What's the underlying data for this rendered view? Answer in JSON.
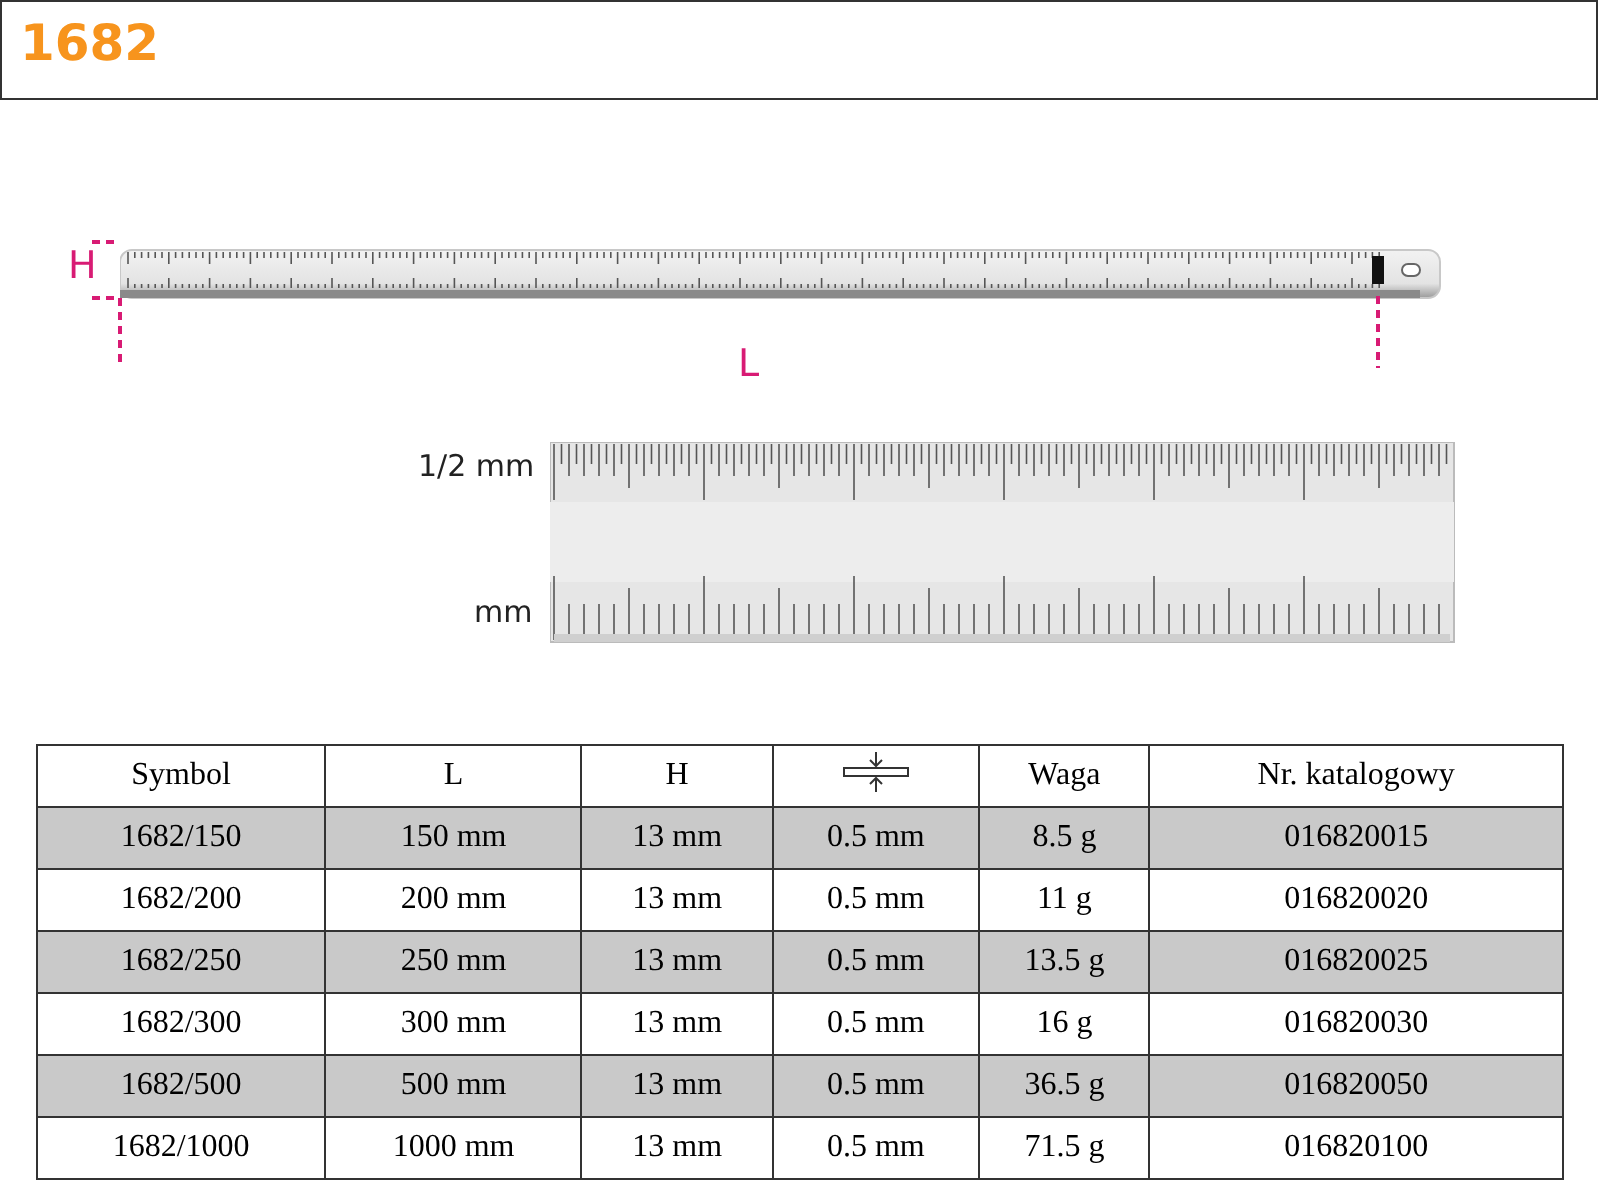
{
  "header": {
    "title": "1682"
  },
  "diagram": {
    "height_label": "H",
    "length_label": "L",
    "scale_labels": [
      "1/2 mm",
      "mm"
    ]
  },
  "table": {
    "columns": [
      {
        "kind": "text",
        "label": "Symbol"
      },
      {
        "kind": "text",
        "label": "L"
      },
      {
        "kind": "text",
        "label": "H"
      },
      {
        "kind": "icon"
      },
      {
        "kind": "text",
        "label": "Waga"
      },
      {
        "kind": "text",
        "label": "Nr. katalogowy"
      }
    ],
    "rows": [
      [
        "1682/150",
        "150 mm",
        "13 mm",
        "0.5 mm",
        "8.5 g",
        "016820015"
      ],
      [
        "1682/200",
        "200 mm",
        "13 mm",
        "0.5 mm",
        "11 g",
        "016820020"
      ],
      [
        "1682/250",
        "250 mm",
        "13 mm",
        "0.5 mm",
        "13.5 g",
        "016820025"
      ],
      [
        "1682/300",
        "300 mm",
        "13 mm",
        "0.5 mm",
        "16 g",
        "016820030"
      ],
      [
        "1682/500",
        "500 mm",
        "13 mm",
        "0.5 mm",
        "36.5 g",
        "016820050"
      ],
      [
        "1682/1000",
        "1000 mm",
        "13 mm",
        "0.5 mm",
        "71.5 g",
        "016820100"
      ]
    ]
  }
}
